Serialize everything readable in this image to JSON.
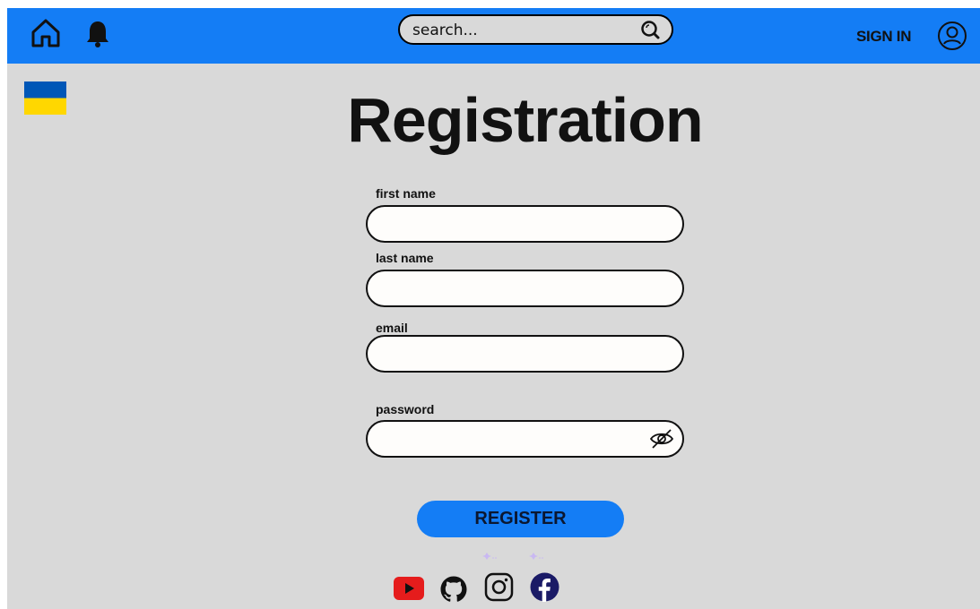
{
  "header": {
    "search": {
      "placeholder": "search..."
    },
    "signin_label": "SIGN IN",
    "icons": [
      "home-icon",
      "bell-icon",
      "search-icon",
      "user-icon"
    ]
  },
  "flag": {
    "name": "ukraine-flag",
    "colors": [
      "#0057b7",
      "#ffd700"
    ]
  },
  "page_title": "Registration",
  "form": {
    "fields": [
      {
        "label": "first name",
        "value": ""
      },
      {
        "label": "last name",
        "value": ""
      },
      {
        "label": "email",
        "value": ""
      },
      {
        "label": "password",
        "value": ""
      }
    ],
    "password_toggle_icon": "eye-slash-icon",
    "register_label": "REGISTER"
  },
  "social": [
    "youtube-icon",
    "github-icon",
    "instagram-icon",
    "facebook-icon"
  ],
  "colors": {
    "accent": "#147df5",
    "background": "#d9d9d9",
    "field_bg": "#fefdfb",
    "youtube": "#e51c1c",
    "facebook": "#1a1a66"
  }
}
